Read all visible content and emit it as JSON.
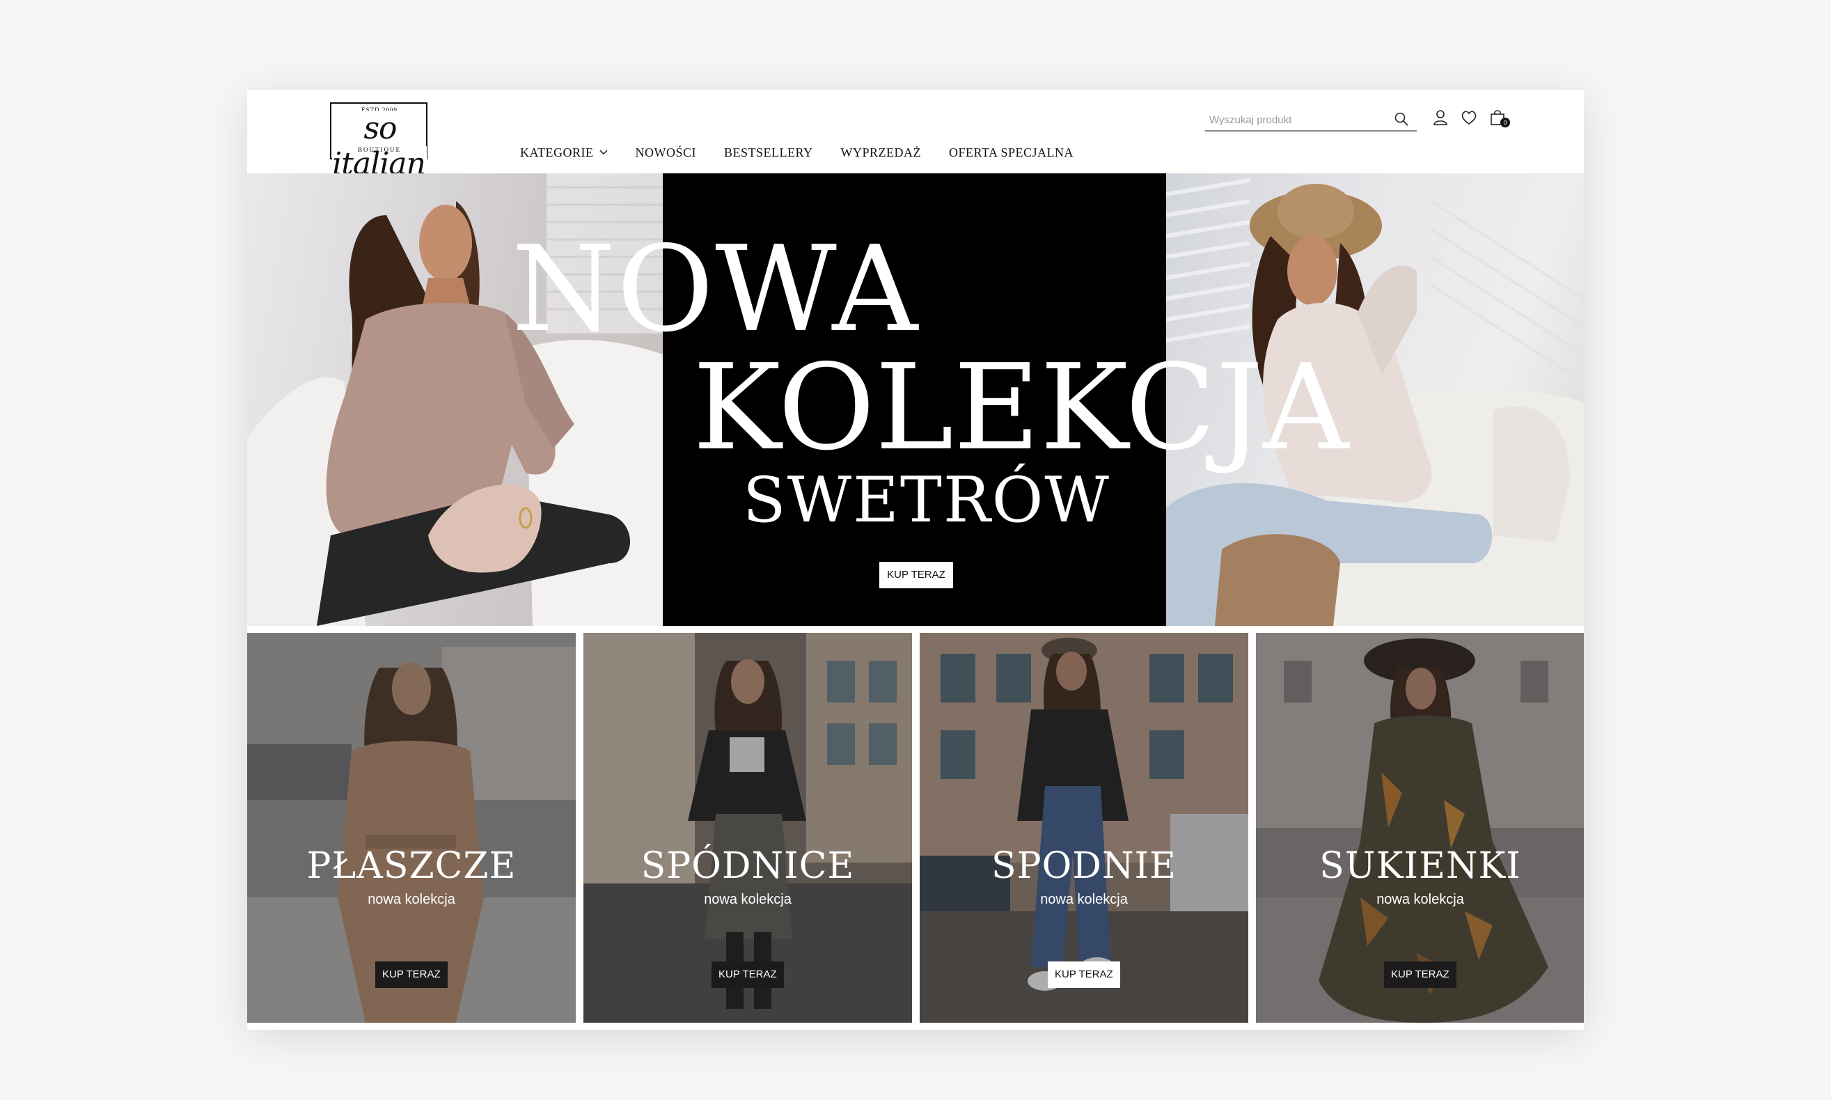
{
  "logo": {
    "estd": "ESTD 2009",
    "name": "so italian",
    "tagline": "BOUTIQUE"
  },
  "nav": {
    "items": [
      {
        "label": "KATEGORIE",
        "has_dropdown": true
      },
      {
        "label": "NOWOŚCI"
      },
      {
        "label": "BESTSELLERY"
      },
      {
        "label": "WYPRZEDAŻ"
      },
      {
        "label": "OFERTA SPECJALNA"
      }
    ]
  },
  "header": {
    "search_placeholder": "Wyszukaj produkt",
    "cart_count": "0"
  },
  "hero": {
    "line1": "NOWA",
    "line2": "KOLEKCJA",
    "line3": "SWETRÓW",
    "cta": "KUP TERAZ"
  },
  "tiles": [
    {
      "title": "PŁASZCZE",
      "subtitle": "nowa kolekcja",
      "cta": "KUP TERAZ",
      "button_style": "dark"
    },
    {
      "title": "SPÓDNICE",
      "subtitle": "nowa kolekcja",
      "cta": "KUP TERAZ",
      "button_style": "dark"
    },
    {
      "title": "SPODNIE",
      "subtitle": "nowa kolekcja",
      "cta": "KUP TERAZ",
      "button_style": "light"
    },
    {
      "title": "SUKIENKI",
      "subtitle": "nowa kolekcja",
      "cta": "KUP TERAZ",
      "button_style": "dark"
    }
  ],
  "colors": {
    "accent": "#000000",
    "text": "#111111",
    "background": "#ffffff"
  }
}
